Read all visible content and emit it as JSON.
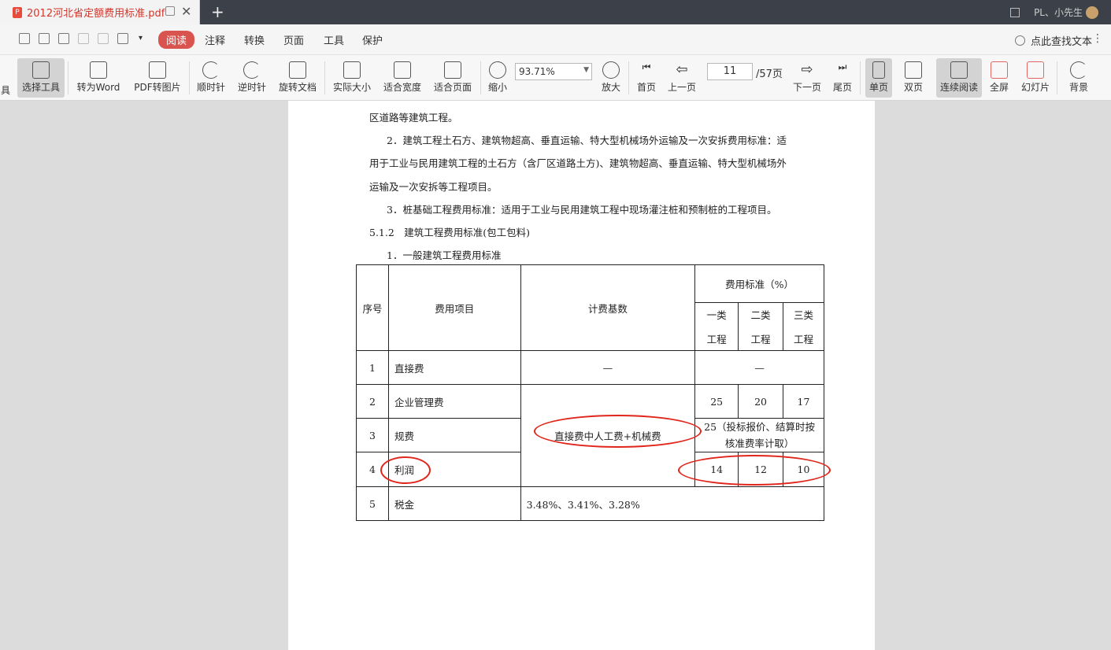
{
  "tab": {
    "title": "2012河北省定额费用标准.pdf",
    "icon": "pdf-icon"
  },
  "account": {
    "user": "PL、小先生"
  },
  "menu": {
    "items": [
      "阅读",
      "注释",
      "转换",
      "页面",
      "工具",
      "保护"
    ],
    "search": "点此查找文本"
  },
  "toolbar": {
    "partial": "具",
    "select": "选择工具",
    "to_word": "转为Word",
    "pdf_to_img": "PDF转图片",
    "cw": "顺时针",
    "ccw": "逆时针",
    "rotate_doc": "旋转文档",
    "actual": "实际大小",
    "fit_width": "适合宽度",
    "fit_page": "适合页面",
    "zoom_out": "缩小",
    "zoom_value": "93.71%",
    "zoom_in": "放大",
    "first": "首页",
    "prev": "上一页",
    "page_current": "11",
    "page_total": "/57页",
    "next": "下一页",
    "last": "尾页",
    "single": "单页",
    "double": "双页",
    "continuous": "连续阅读",
    "fullscreen": "全屏",
    "slides": "幻灯片",
    "background": "背景"
  },
  "document": {
    "lines": [
      "区道路等建筑工程。",
      "2．建筑工程土石方、建筑物超高、垂直运输、特大型机械场外运输及一次安拆费用标准：适",
      "用于工业与民用建筑工程的土石方（含厂区道路土方)、建筑物超高、垂直运输、特大型机械场外",
      "运输及一次安拆等工程项目。",
      "3．桩基础工程费用标准：适用于工业与民用建筑工程中现场灌注桩和预制桩的工程项目。",
      "5.1.2　建筑工程费用标准(包工包料)",
      "1．一般建筑工程费用标准"
    ],
    "table": {
      "h_no": "序号",
      "h_item": "费用项目",
      "h_base": "计费基数",
      "h_std": "费用标准（%）",
      "h_c1a": "一类",
      "h_c1b": "工程",
      "h_c2a": "二类",
      "h_c2b": "工程",
      "h_c3a": "三类",
      "h_c3b": "工程",
      "r1_no": "1",
      "r1_item": "直接费",
      "r1_base": "—",
      "r1_std": "—",
      "r2_no": "2",
      "r2_item": "企业管理费",
      "r2_c1": "25",
      "r2_c2": "20",
      "r2_c3": "17",
      "base_merged": "直接费中人工费+机械费",
      "r3_no": "3",
      "r3_item": "规费",
      "r3_std_a": "25（投标报价、结算时按",
      "r3_std_b": "核准费率计取）",
      "r4_no": "4",
      "r4_item": "利润",
      "r4_c1": "14",
      "r4_c2": "12",
      "r4_c3": "10",
      "r5_no": "5",
      "r5_item": "税金",
      "r5_base": "3.48%、3.41%、3.28%"
    }
  }
}
